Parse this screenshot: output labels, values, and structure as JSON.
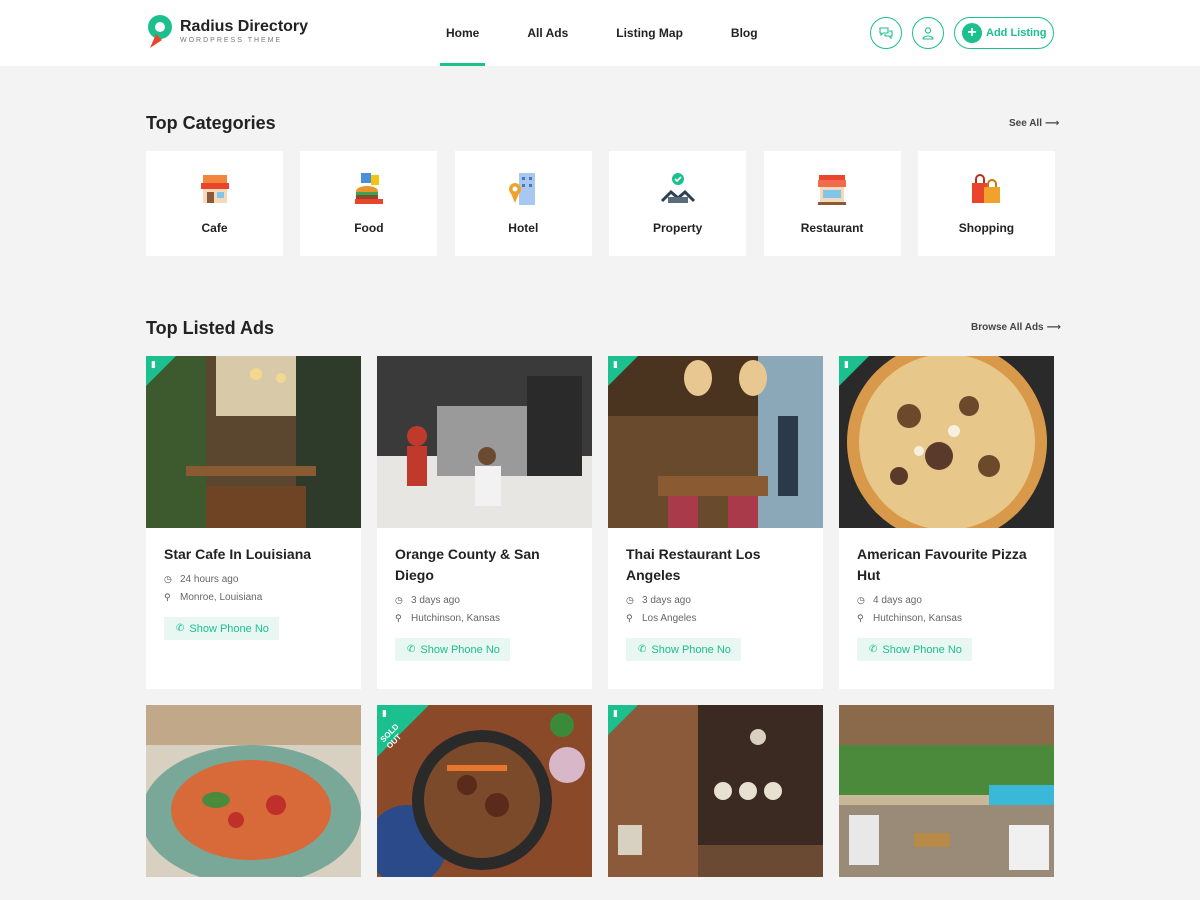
{
  "header": {
    "logo_title": "Radius Directory",
    "logo_subtitle": "WORDPRESS THEME",
    "nav": [
      {
        "label": "Home",
        "active": true
      },
      {
        "label": "All Ads",
        "active": false
      },
      {
        "label": "Listing Map",
        "active": false
      },
      {
        "label": "Blog",
        "active": false
      }
    ],
    "chat_icon": "chat-bubbles-icon",
    "user_icon": "user-icon",
    "add_listing_label": "Add Listing",
    "accent": "#1cbf8e"
  },
  "categories": {
    "title": "Top Categories",
    "see_all": "See All",
    "items": [
      {
        "label": "Cafe",
        "icon": "cafe-icon"
      },
      {
        "label": "Food",
        "icon": "food-icon"
      },
      {
        "label": "Hotel",
        "icon": "hotel-icon"
      },
      {
        "label": "Property",
        "icon": "property-icon"
      },
      {
        "label": "Restaurant",
        "icon": "restaurant-icon"
      },
      {
        "label": "Shopping",
        "icon": "shopping-icon"
      }
    ]
  },
  "ads": {
    "title": "Top Listed Ads",
    "browse_all": "Browse All Ads",
    "show_phone_label": "Show Phone No",
    "items": [
      {
        "title": "Star Cafe In Louisiana",
        "time": "24 hours ago",
        "location": "Monroe, Louisiana",
        "featured": true
      },
      {
        "title": "Orange County & San Diego",
        "time": "3 days ago",
        "location": "Hutchinson, Kansas",
        "featured": false
      },
      {
        "title": "Thai Restaurant Los Angeles",
        "time": "3 days ago",
        "location": "Los Angeles",
        "featured": true
      },
      {
        "title": "American Favourite Pizza Hut",
        "time": "4 days ago",
        "location": "Hutchinson, Kansas",
        "featured": true
      }
    ],
    "row2": [
      {
        "featured": false,
        "sold": false
      },
      {
        "featured": true,
        "sold": true,
        "sold_label": "SOLD OUT"
      },
      {
        "featured": true,
        "sold": false
      },
      {
        "featured": false,
        "sold": false
      }
    ]
  }
}
